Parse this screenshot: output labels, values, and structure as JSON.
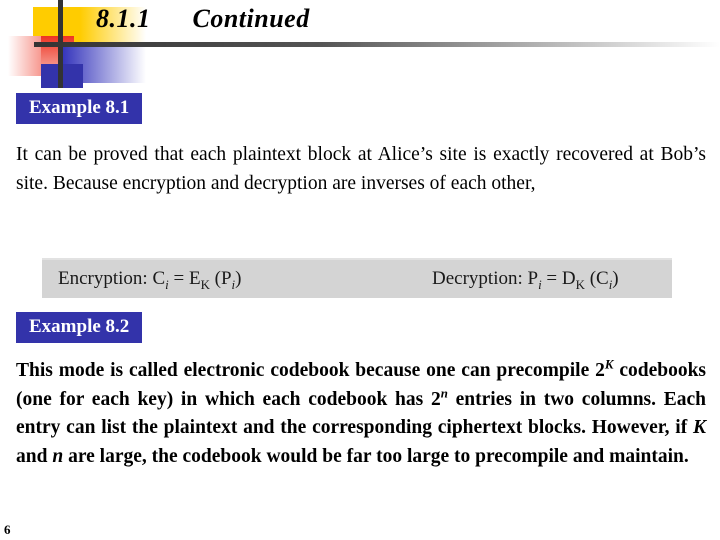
{
  "slide": {
    "title": "8.1.1      Continued",
    "page_number": "6",
    "accent_blue": "#3333aa",
    "accent_yellow": "#ffcc00",
    "accent_red": "#ee3322",
    "formula_band_bg": "#d4d4d4"
  },
  "example_1": {
    "label": "Example 8.1",
    "body": "It can be proved that each plaintext block at Alice’s site is exactly recovered at Bob’s site. Because encryption and decryption are inverses of each other,"
  },
  "formulas": {
    "encryption": {
      "prefix": "Encryption: C",
      "sub1": "i",
      "equals": " = E",
      "sub2": "K",
      "open": " (P",
      "sub3": "i",
      "close": ")"
    },
    "decryption": {
      "prefix": "Decryption: P",
      "sub1": "i",
      "equals": " = D",
      "sub2": "K",
      "open": " (C",
      "sub3": "i",
      "close": ")"
    }
  },
  "example_2": {
    "label": "Example 8.2",
    "segment_1": "This mode is called electronic codebook because one can precompile 2",
    "sup_1": "K",
    "segment_2": " codebooks (one for each key) in which each codebook has 2",
    "sup_2": "n",
    "segment_3": " entries in two columns. Each entry can list the plaintext and the corresponding ciphertext blocks. However, if ",
    "var_1": "K",
    "segment_4": " and ",
    "var_2": "n",
    "segment_5": " are large, the codebook would be far too large to precompile and maintain."
  }
}
